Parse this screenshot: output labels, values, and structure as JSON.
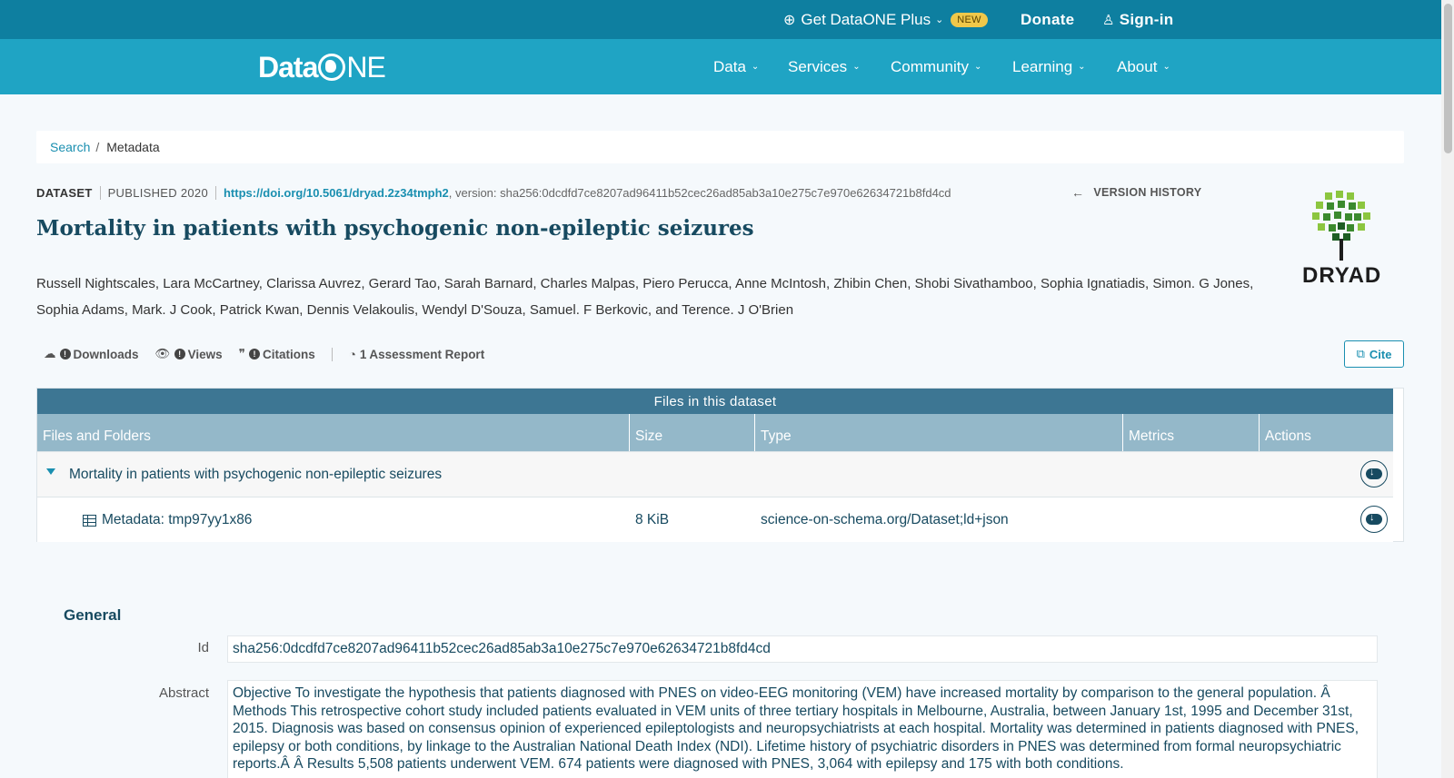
{
  "topbar": {
    "plus_label": "Get DataONE Plus",
    "plus_badge": "NEW",
    "donate": "Donate",
    "signin": "Sign-in"
  },
  "logo": {
    "part1": "Data",
    "part2": "NE"
  },
  "nav": [
    {
      "label": "Data"
    },
    {
      "label": "Services"
    },
    {
      "label": "Community"
    },
    {
      "label": "Learning"
    },
    {
      "label": "About"
    }
  ],
  "breadcrumb": {
    "link": "Search",
    "sep": "/",
    "current": "Metadata"
  },
  "meta": {
    "type": "DATASET",
    "published": "PUBLISHED 2020",
    "doi": "https://doi.org/10.5061/dryad.2z34tmph2",
    "version": ", version: sha256:0dcdfd7ce8207ad96411b52cec26ad85ab3a10e275c7e970e62634721b8fd4cd",
    "version_history": "VERSION HISTORY"
  },
  "title": "Mortality in patients with psychogenic non-epileptic seizures",
  "authors": "Russell Nightscales, Lara McCartney, Clarissa Auvrez, Gerard Tao, Sarah Barnard, Charles Malpas, Piero Perucca, Anne McIntosh, Zhibin Chen, Shobi Sivathamboo, Sophia Ignatiadis, Simon. G Jones, Sophia Adams, Mark. J Cook, Patrick Kwan, Dennis Velakoulis, Wendyl D'Souza, Samuel. F Berkovic, and Terence. J O'Brien",
  "repository": {
    "name": "DRYAD"
  },
  "metrics": {
    "downloads": "Downloads",
    "views": "Views",
    "citations": "Citations",
    "assessment_count": "1",
    "assessment_label": "Assessment Report",
    "cite": "Cite"
  },
  "files": {
    "caption": "Files in this dataset",
    "headers": [
      "Files and Folders",
      "Size",
      "Type",
      "Metrics",
      "Actions"
    ],
    "rows": [
      {
        "name": "Mortality in patients with psychogenic non-epileptic seizures",
        "size": "",
        "type": ""
      },
      {
        "name": "Metadata: tmp97yy1x86",
        "size": "8 KiB",
        "type": "science-on-schema.org/Dataset;ld+json"
      }
    ]
  },
  "general": {
    "heading": "General",
    "id_label": "Id",
    "id_value": "sha256:0dcdfd7ce8207ad96411b52cec26ad85ab3a10e275c7e970e62634721b8fd4cd",
    "abstract_label": "Abstract",
    "abstract": "Objective To investigate the hypothesis that patients diagnosed with PNES on video-EEG monitoring (VEM) have increased mortality by comparison to the general population. Â  Methods This retrospective cohort study included patients evaluated in VEM units of three tertiary hospitals in Melbourne, Australia, between January 1st, 1995 and December 31st, 2015. Diagnosis was based on consensus opinion of experienced epileptologists and neuropsychiatrists at each hospital. Mortality was determined in patients diagnosed with PNES, epilepsy or both conditions, by linkage to the Australian National Death Index (NDI). Lifetime history of psychiatric disorders in PNES was determined from formal neuropsychiatric reports.Â  Â  Results 5,508 patients underwent VEM. 674 patients were diagnosed with PNES, 3,064 with epilepsy and 175 with both conditions."
  }
}
